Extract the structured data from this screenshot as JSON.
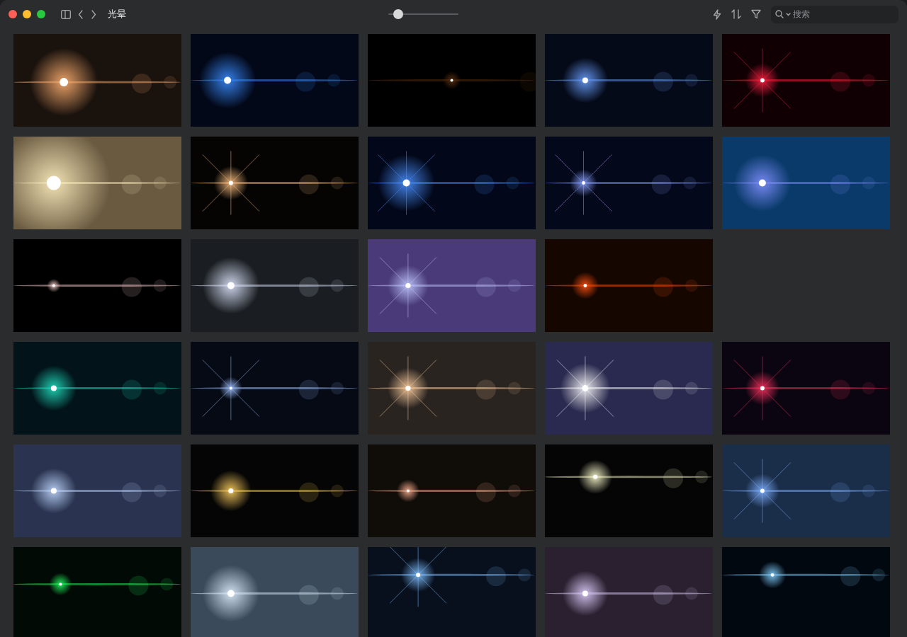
{
  "window": {
    "title": "光晕"
  },
  "zoom_slider": {
    "level": 0.14
  },
  "search": {
    "placeholder": "搜索"
  }
}
